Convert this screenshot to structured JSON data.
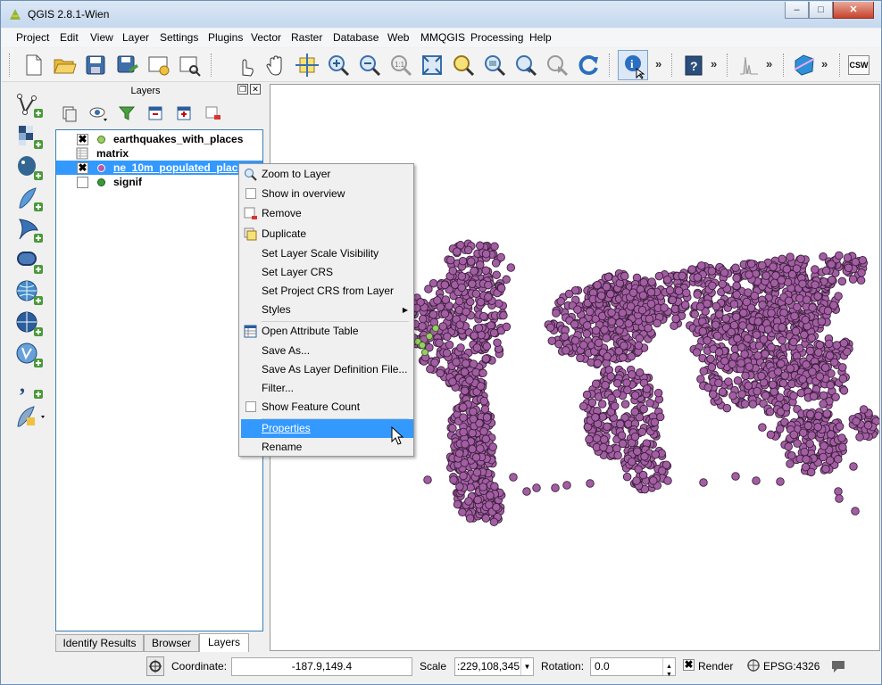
{
  "window": {
    "title": "QGIS 2.8.1-Wien",
    "minimize": "‒",
    "maximize": "□",
    "close": "✕"
  },
  "menu": [
    "Project",
    "Edit",
    "View",
    "Layer",
    "Settings",
    "Plugins",
    "Vector",
    "Raster",
    "Database",
    "Web",
    "MMQGIS",
    "Processing",
    "Help"
  ],
  "toolbar": {
    "more": "»",
    "csw": "CSW"
  },
  "layers_panel": {
    "title": "Layers",
    "layers": [
      {
        "name": "earthquakes_with_places",
        "checked": "✖",
        "color": "#9ccc65"
      },
      {
        "name": "matrix",
        "checked": "",
        "color": ""
      },
      {
        "name": "ne_10m_populated_plac",
        "checked": "✖",
        "color": "#b05ab0"
      },
      {
        "name": "signif",
        "checked": "",
        "color": "#3a9a3a"
      }
    ],
    "tabs": [
      "Identify Results",
      "Browser",
      "Layers"
    ]
  },
  "context_menu": {
    "items": [
      "Zoom to Layer",
      "Show in overview",
      "Remove",
      "Duplicate",
      "Set Layer Scale Visibility",
      "Set Layer CRS",
      "Set Project CRS from Layer",
      "Styles",
      "Open Attribute Table",
      "Save As...",
      "Save As Layer Definition File...",
      "Filter...",
      "Show Feature Count",
      "Properties",
      "Rename"
    ],
    "highlighted": "Properties",
    "submenu_arrow": "▶"
  },
  "status": {
    "coordinate_label": "Coordinate:",
    "coordinate_value": "-187.9,149.4",
    "scale_label": "Scale",
    "scale_value": ":229,108,345",
    "rotation_label": "Rotation:",
    "rotation_value": "0.0",
    "render_label": "Render",
    "render_checked": "✖",
    "crs": "EPSG:4326"
  },
  "colors": {
    "point_fill": "#a35ea3",
    "point_stroke": "#3b1f3b",
    "selection": "#3399ff"
  }
}
